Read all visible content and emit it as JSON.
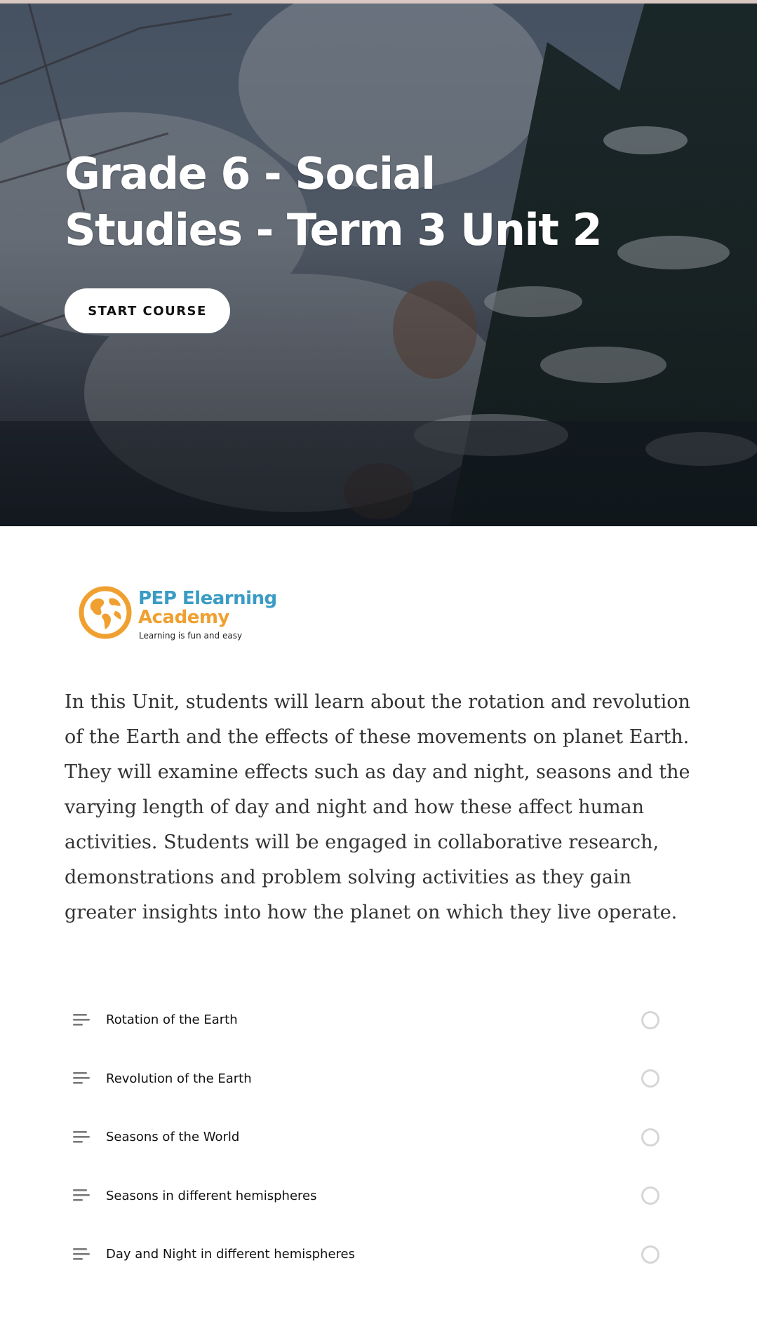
{
  "hero": {
    "title": "Grade 6 - Social Studies - Term 3 Unit 2",
    "start_button_label": "START COURSE"
  },
  "logo": {
    "name_line1": "PEP Elearning",
    "name_line2": "Academy",
    "tagline": "Learning is fun and easy",
    "colors": {
      "blue": "#3a9cc4",
      "orange": "#f0a030"
    }
  },
  "description": "In this Unit, students will learn about the rotation and revolution of the Earth and the effects of these movements on planet Earth. They will examine effects such as day and night, seasons and the varying length of day and night and how these affect human activities. Students will be engaged in collaborative research, demonstrations and problem solving activities as they gain greater insights into how the planet on which they live operate.",
  "lessons": [
    {
      "title": "Rotation of the Earth",
      "icon": "lesson-lines-icon",
      "status": "incomplete"
    },
    {
      "title": "Revolution of the Earth",
      "icon": "lesson-lines-icon",
      "status": "incomplete"
    },
    {
      "title": "Seasons of the World",
      "icon": "lesson-lines-icon",
      "status": "incomplete"
    },
    {
      "title": "Seasons in different hemispheres",
      "icon": "lesson-lines-icon",
      "status": "incomplete"
    },
    {
      "title": "Day and Night in different hemispheres",
      "icon": "lesson-lines-icon",
      "status": "incomplete"
    }
  ]
}
